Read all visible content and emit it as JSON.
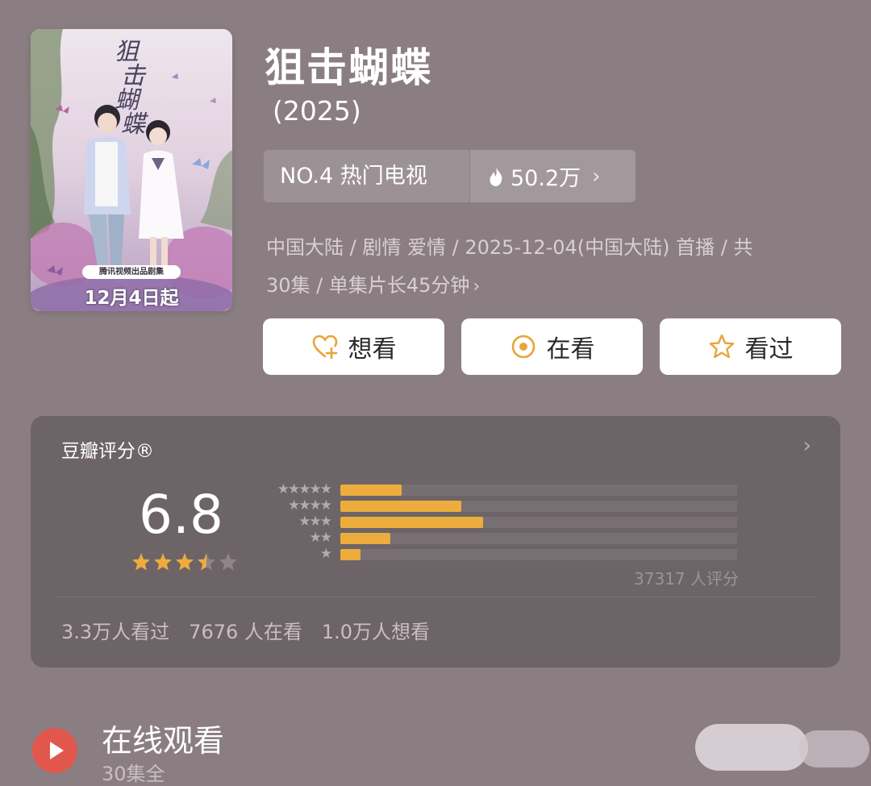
{
  "poster": {
    "title_chars": "狙击蝴蝶",
    "badge": "腾讯视频出品剧集",
    "date": "12月4日起"
  },
  "header": {
    "title": "狙击蝴蝶",
    "year": "(2025)"
  },
  "rank": {
    "label": "NO.4 热门电视",
    "heat": "50.2万",
    "accent": "#ffffff"
  },
  "meta": {
    "line1": "中国大陆 / 剧情 爱情 / 2025-12-04(中国大陆) 首播 / 共",
    "line2": "30集 / 单集片长45分钟"
  },
  "actions": {
    "want": "想看",
    "doing": "在看",
    "done": "看过",
    "icon_color": "#e8a43a"
  },
  "rating": {
    "title": "豆瓣评分®",
    "score": "6.8",
    "stars_value": 3.5,
    "stars_max": 5,
    "count": "37317 人评分",
    "distribution": [
      {
        "stars": "★★★★★",
        "fraction": 0.155
      },
      {
        "stars": "★★★★",
        "fraction": 0.305
      },
      {
        "stars": "★★★",
        "fraction": 0.36
      },
      {
        "stars": "★★",
        "fraction": 0.127
      },
      {
        "stars": "★",
        "fraction": 0.05
      }
    ],
    "bar_color": "#ecac3e",
    "stats": {
      "watched": "3.3万人看过",
      "watching": "7676 人在看",
      "want": "1.0万人想看"
    }
  },
  "online": {
    "title": "在线观看",
    "sub": "30集全"
  }
}
